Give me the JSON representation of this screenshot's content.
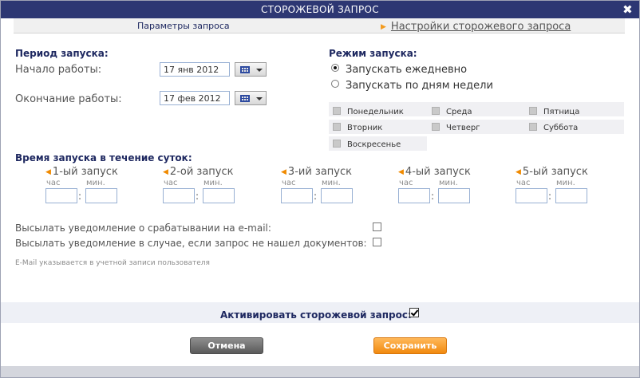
{
  "dialog": {
    "title": "СТОРОЖЕВОЙ ЗАПРОС",
    "close_glyph": "✖"
  },
  "tabs": [
    {
      "label": "Параметры запроса",
      "active": false
    },
    {
      "label": "Настройки сторожевого запроса",
      "active": true
    }
  ],
  "period": {
    "heading": "Период запуска:",
    "start_label": "Начало работы:",
    "start_value": "17 янв 2012",
    "end_label": "Окончание работы:",
    "end_value": "17 фев 2012"
  },
  "mode": {
    "heading": "Режим запуска:",
    "options": [
      {
        "label": "Запускать ежедневно",
        "selected": true
      },
      {
        "label": "Запускать по дням недели",
        "selected": false
      }
    ],
    "days": [
      "Понедельник",
      "Среда",
      "Пятница",
      "Вторник",
      "Четверг",
      "Суббота",
      "Воскресенье"
    ]
  },
  "times": {
    "heading": "Время запуска в течение суток:",
    "hour_label": "час",
    "min_label": "мин.",
    "colon": ":",
    "runs": [
      "1-ый запуск",
      "2-ой запуск",
      "3-ий запуск",
      "4-ый запуск",
      "5-ый запуск"
    ]
  },
  "notify": {
    "email_label": "Высылать уведомление о срабатывании на e-mail:",
    "empty_label": "Высылать уведомление в случае, если запрос не нашел документов:",
    "hint": "E-Mail указывается в учетной записи пользователя"
  },
  "activate": {
    "label": "Активировать сторожевой запрос:",
    "checked": true
  },
  "buttons": {
    "cancel": "Отмена",
    "save": "Сохранить"
  }
}
